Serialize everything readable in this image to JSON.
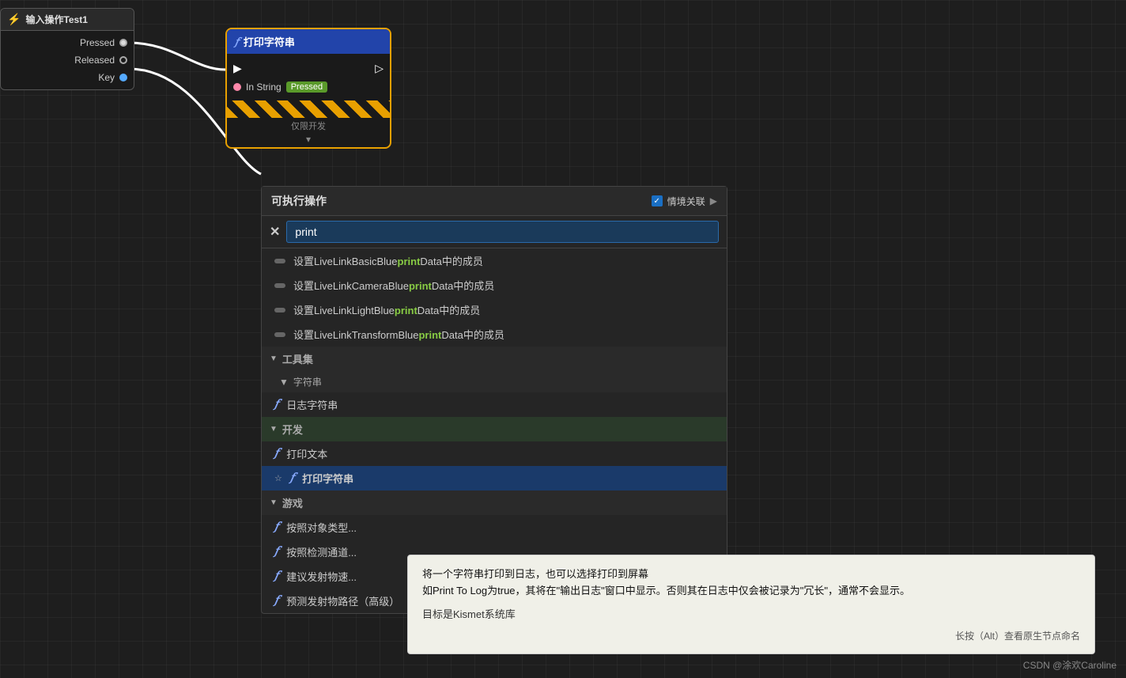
{
  "background": {
    "color": "#1e1e1e"
  },
  "input_node": {
    "title": "输入操作Test1",
    "lightning": "⚡",
    "pins": [
      {
        "label": "Pressed",
        "type": "exec"
      },
      {
        "label": "Released",
        "type": "exec_outline"
      },
      {
        "label": "Key",
        "type": "dot"
      }
    ]
  },
  "print_node": {
    "title": "打印字符串",
    "func_icon": "f",
    "in_string_label": "In String",
    "pressed_value": "Pressed",
    "warning_label": "仅限开发"
  },
  "search_panel": {
    "title": "可执行操作",
    "context_label": "情境关联",
    "search_value": "print",
    "results": [
      {
        "text_before": "设置LiveLinkBasicBlue",
        "highlight": "print",
        "text_after": "Data中的成员"
      },
      {
        "text_before": "设置LiveLinkCameraBlue",
        "highlight": "print",
        "text_after": "Data中的成员"
      },
      {
        "text_before": "设置LiveLinkLightBlue",
        "highlight": "print",
        "text_after": "Data中的成员"
      },
      {
        "text_before": "设置LiveLinkTransformBlue",
        "highlight": "print",
        "text_after": "Data中的成员"
      }
    ],
    "sections": [
      {
        "name": "工具集",
        "subsections": [
          {
            "name": "字符串",
            "items": [
              {
                "label": "日志字符串"
              }
            ]
          }
        ]
      },
      {
        "name": "开发",
        "items": [
          {
            "label": "打印文本"
          },
          {
            "label": "打印字符串",
            "selected": true
          }
        ]
      },
      {
        "name": "游戏",
        "items": [
          {
            "label": "按照对象类型..."
          },
          {
            "label": "按照检测通道..."
          },
          {
            "label": "建议发射物速..."
          },
          {
            "label": "预测发射物路径（高级）"
          }
        ]
      }
    ]
  },
  "tooltip": {
    "main_line1": "将一个字符串打印到日志，也可以选择打印到屏幕",
    "main_line2": "如Print To Log为true，其将在\"输出日志\"窗口中显示。否则其在日志中仅会被记录为\"冗长\"，通常不会显示。",
    "target_label": "目标是Kismet系统库",
    "hint": "长按（Alt）查看原生节点命名"
  },
  "watermark": "CSDN @涂欢Caroline"
}
